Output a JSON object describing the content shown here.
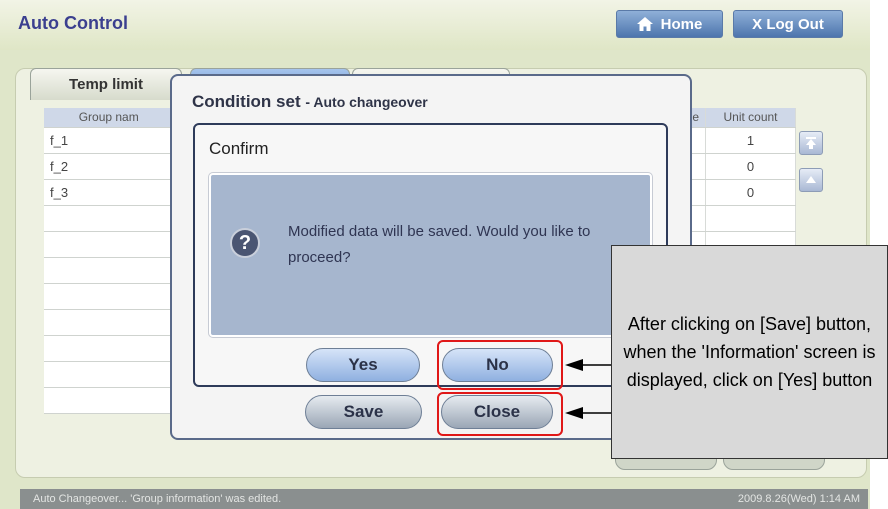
{
  "app": {
    "title": "Auto Control"
  },
  "topbar": {
    "home_label": "Home",
    "logout_label": "X Log Out"
  },
  "tabs": [
    {
      "label": "Temp limit"
    },
    {
      "label": ""
    },
    {
      "label": ""
    }
  ],
  "table": {
    "headers": [
      "Group nam",
      "Unit count"
    ],
    "rows": [
      {
        "group": "f_1",
        "count": "1"
      },
      {
        "group": "f_2",
        "count": "0"
      },
      {
        "group": "f_3",
        "count": "0"
      },
      {
        "group": "",
        "count": ""
      },
      {
        "group": "",
        "count": ""
      },
      {
        "group": "",
        "count": ""
      },
      {
        "group": "",
        "count": ""
      },
      {
        "group": "",
        "count": ""
      },
      {
        "group": "",
        "count": ""
      },
      {
        "group": "",
        "count": ""
      },
      {
        "group": "",
        "count": ""
      }
    ],
    "partial_header": "e"
  },
  "condition_dialog": {
    "title": "Condition set",
    "subtitle": "- Auto changeover",
    "save_label": "Save",
    "close_label": "Close"
  },
  "confirm_dialog": {
    "title": "Confirm",
    "message": "Modified data will be saved.  Would you like to proceed?",
    "yes_label": "Yes",
    "no_label": "No"
  },
  "callout": {
    "text": "After clicking on [Save] button, when the 'Information' screen is displayed, click on [Yes] button"
  },
  "statusbar": {
    "message": "Auto Changeover... 'Group information' was edited.",
    "datetime": "2009.8.26(Wed)  1:14 AM"
  },
  "icons": {
    "home": "home-icon",
    "question": "question-icon",
    "scroll_top": "scroll-top-icon",
    "scroll_up": "scroll-up-icon"
  },
  "colors": {
    "highlight": "#e01818",
    "title": "#3b3f8f"
  }
}
